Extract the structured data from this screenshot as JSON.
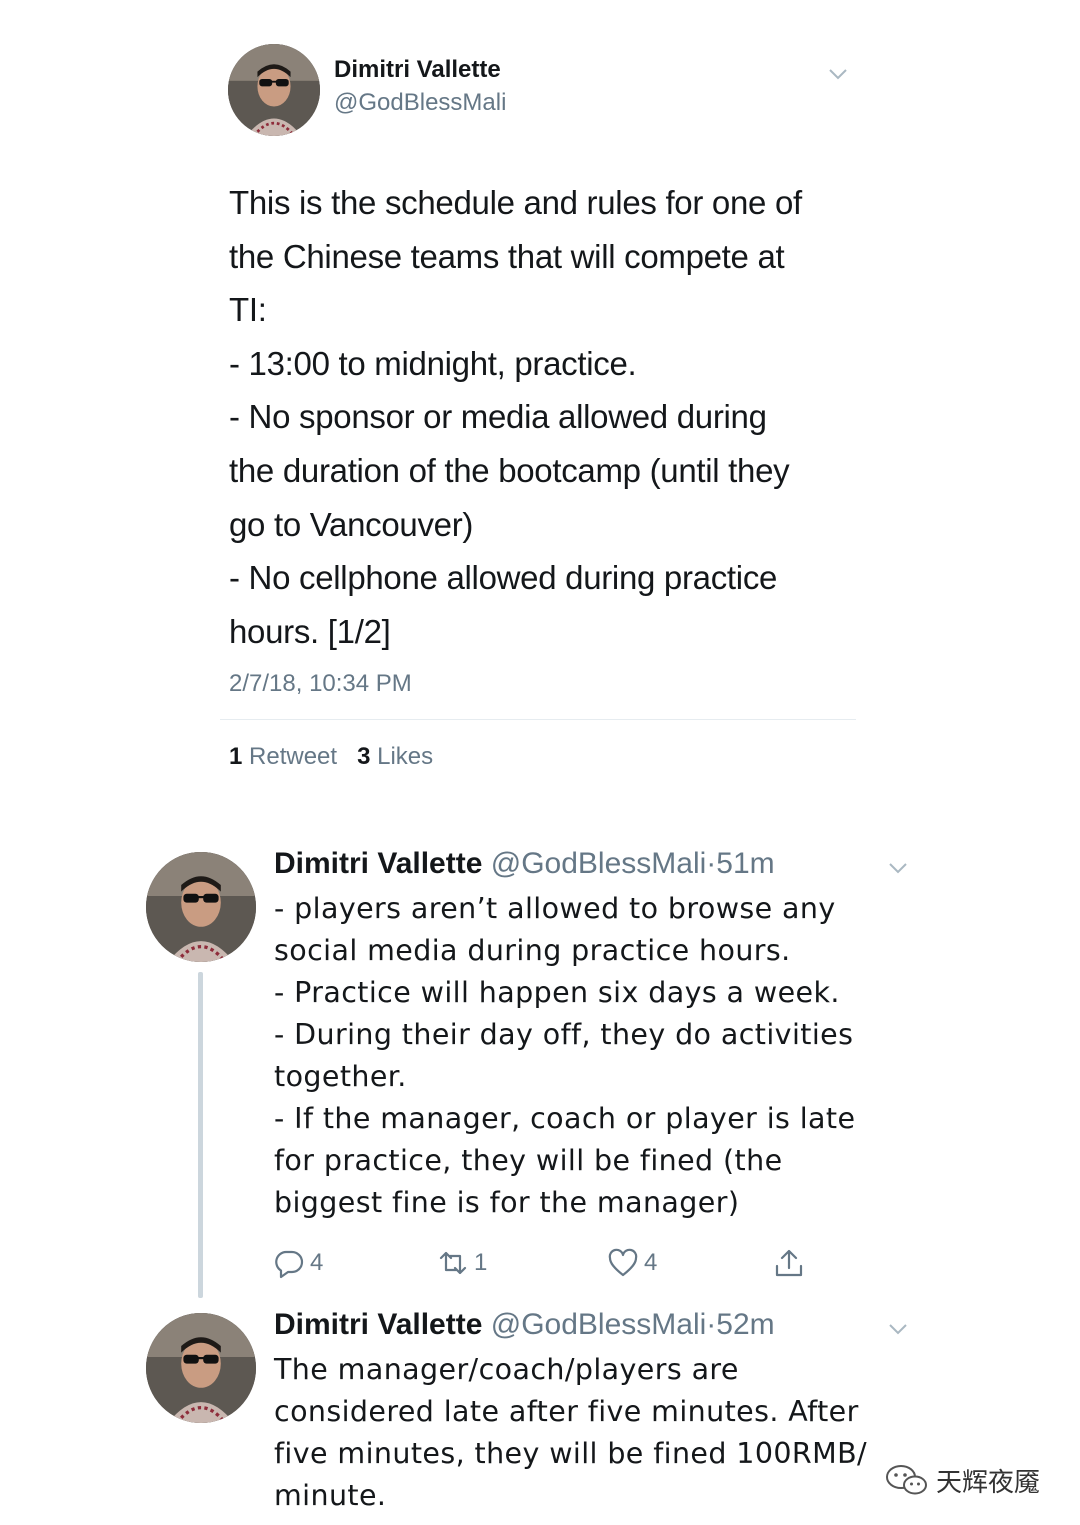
{
  "main_tweet": {
    "name": "Dimitri Vallette",
    "handle": "@GodBlessMali",
    "text_lines": [
      "This is the schedule and rules for one of",
      "the Chinese teams that will compete at",
      "TI:",
      "- 13:00 to midnight, practice.",
      "- No sponsor or media allowed during",
      "the duration of the bootcamp (until they",
      "go to Vancouver)",
      "- No cellphone allowed during practice",
      "hours. [1/2]"
    ],
    "timestamp": "2/7/18, 10:34 PM",
    "retweets_count": "1",
    "retweets_label": "Retweet",
    "likes_count": "3",
    "likes_label": "Likes"
  },
  "replies": [
    {
      "name": "Dimitri Vallette",
      "handle": "@GodBlessMali",
      "time": "51m",
      "text_lines": [
        "- players aren’t allowed to browse any",
        "social media during practice hours.",
        "- Practice will happen six days a week.",
        "- During their day off, they do activities",
        "together.",
        "- If the manager, coach or player is late",
        "for practice, they will be fined (the",
        "biggest fine is for the manager)"
      ],
      "actions": {
        "reply_count": "4",
        "retweet_count": "1",
        "like_count": "4"
      }
    },
    {
      "name": "Dimitri Vallette",
      "handle": "@GodBlessMali",
      "time": "52m",
      "text_lines": [
        "The manager/coach/players are",
        "considered late after five minutes. After",
        "five minutes, they will be fined 100RMB/",
        "minute."
      ]
    }
  ],
  "watermark": {
    "text": "天辉夜魇",
    "icon": "wechat-icon"
  },
  "colors": {
    "text": "#14171a",
    "secondary": "#657786",
    "thread_line": "#ccd6dd",
    "divider": "#e6ecf0"
  }
}
